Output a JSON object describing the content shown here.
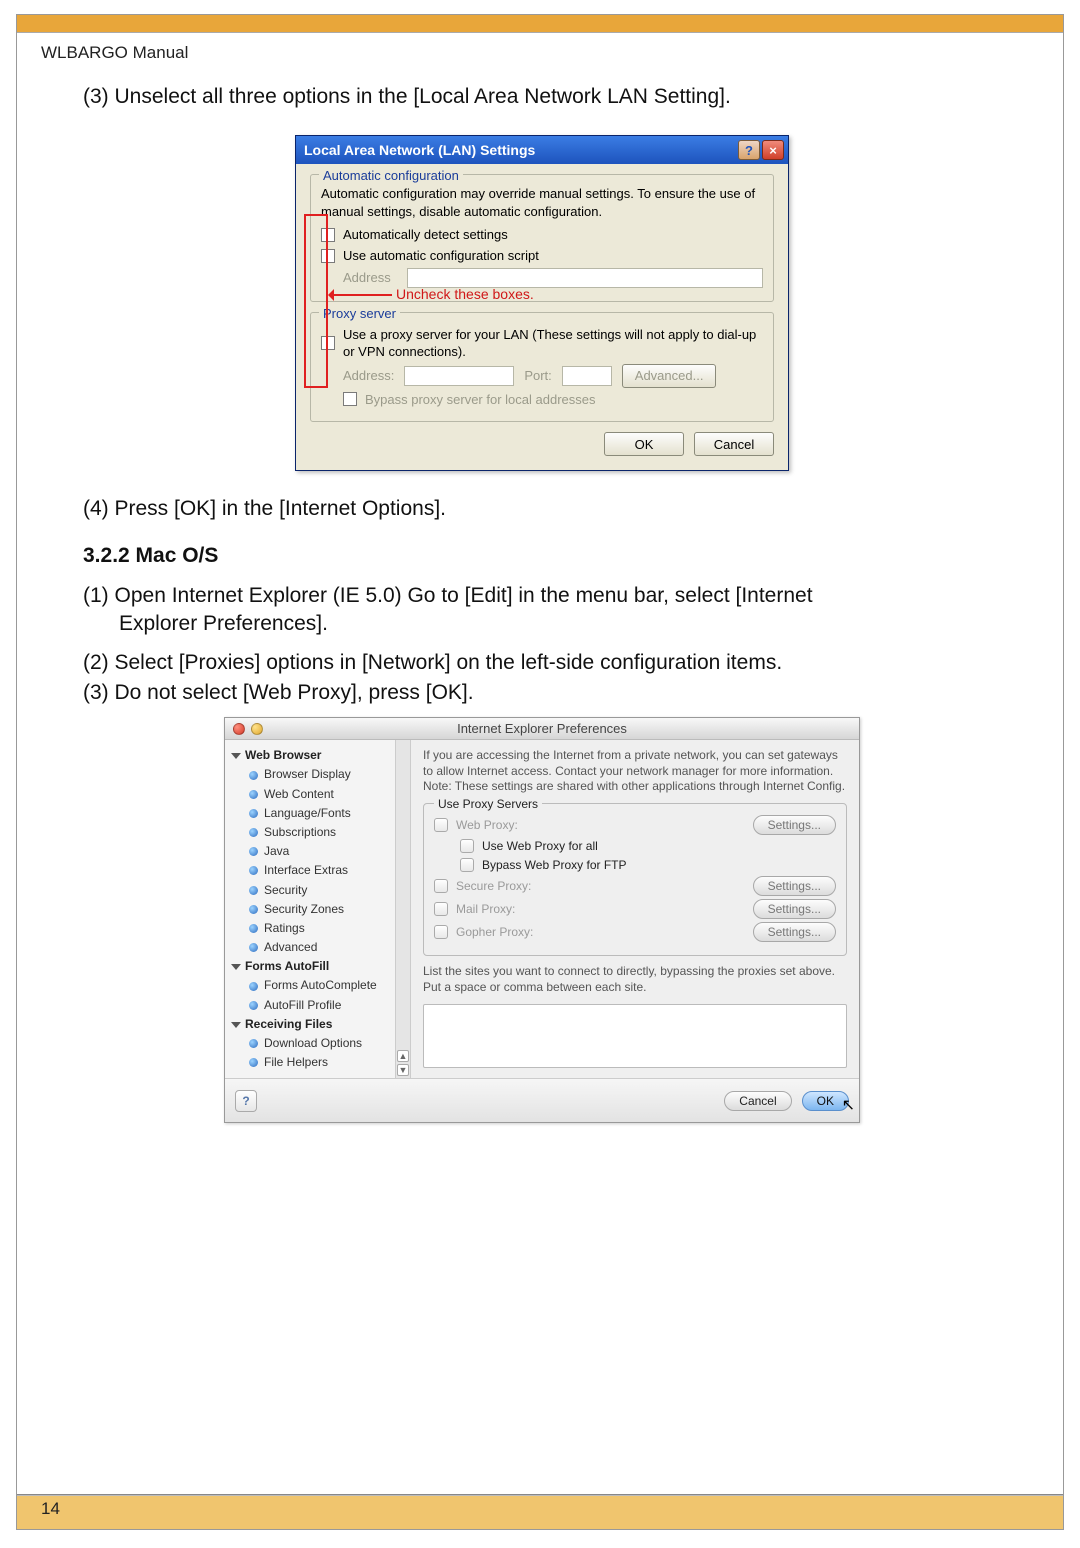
{
  "header": {
    "title": "WLBARGO Manual"
  },
  "steps_top": {
    "s3": "(3) Unselect all three options in the  [Local Area Network LAN Setting].",
    "s4": "(4) Press [OK] in the [Internet Options]."
  },
  "section_heading": "3.2.2 Mac O/S",
  "steps_mac": {
    "s1a": "(1) Open Internet Explorer (IE 5.0) Go to [Edit] in the menu bar, select [Internet",
    "s1b": "Explorer Preferences].",
    "s2": "(2) Select [Proxies] options in [Network] on the left-side configuration items.",
    "s3": "(3) Do not select [Web Proxy], press [OK]."
  },
  "xp": {
    "title": "Local Area Network (LAN) Settings",
    "group1": "Automatic configuration",
    "desc": "Automatic configuration may override manual settings.  To ensure the use of manual settings, disable automatic configuration.",
    "opt1": "Automatically detect settings",
    "opt2": "Use automatic configuration script",
    "address_label": "Address",
    "group2": "Proxy server",
    "proxy_desc": "Use a proxy server for your LAN (These settings will not apply to dial-up or VPN connections).",
    "addr2": "Address:",
    "port": "Port:",
    "advanced": "Advanced...",
    "bypass": "Bypass proxy server for local addresses",
    "ok": "OK",
    "cancel": "Cancel",
    "annotation": "Uncheck these boxes."
  },
  "mac": {
    "title": "Internet Explorer Preferences",
    "sidebar": {
      "cat1": "Web Browser",
      "items1": [
        "Browser Display",
        "Web Content",
        "Language/Fonts",
        "Subscriptions",
        "Java",
        "Interface Extras",
        "Security",
        "Security Zones",
        "Ratings",
        "Advanced"
      ],
      "cat2": "Forms AutoFill",
      "items2": [
        "Forms AutoComplete",
        "AutoFill Profile"
      ],
      "cat3": "Receiving Files",
      "items3": [
        "Download Options",
        "File Helpers"
      ]
    },
    "note": "If you are accessing the Internet from a private network, you can set gateways to allow Internet access.  Contact your network manager for more information.  Note: These settings are shared with other applications through Internet Config.",
    "group": "Use Proxy Servers",
    "rows": {
      "web": "Web Proxy:",
      "use_all": "Use Web Proxy for all",
      "bypass_ftp": "Bypass Web Proxy for FTP",
      "secure": "Secure Proxy:",
      "mail": "Mail Proxy:",
      "gopher": "Gopher Proxy:",
      "settings": "Settings..."
    },
    "list_note": "List the sites you want to connect to directly,  bypassing the proxies set above.  Put a space or comma between each site.",
    "help": "?",
    "cancel": "Cancel",
    "ok": "OK"
  },
  "page_number": "14"
}
